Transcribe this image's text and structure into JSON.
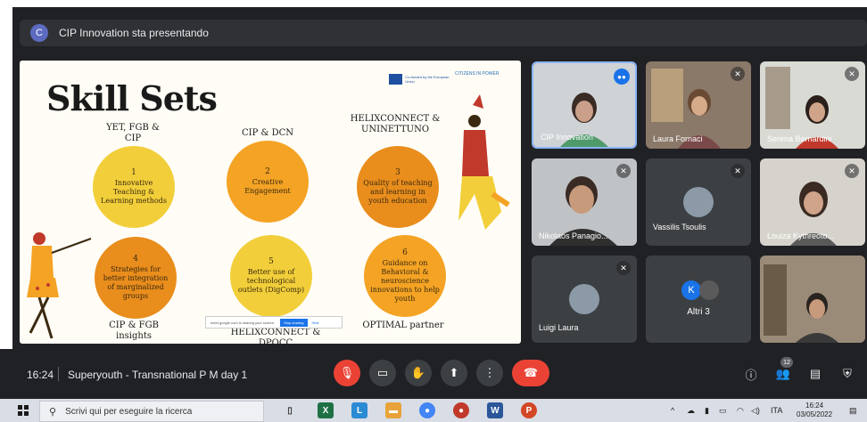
{
  "presenter": {
    "initial": "C",
    "text": "CIP Innovation sta presentando"
  },
  "slide": {
    "title": "Skill Sets",
    "eu_text": "Co-funded by the European Union",
    "citizens_text": "CITIZENS IN POWER",
    "partners": {
      "top_left": "YET, FGB & CIP",
      "top_mid": "CIP & DCN",
      "top_right": "HELIXCONNECT & UNINETTUNO",
      "bottom_left": "CIP & FGB insights",
      "bottom_mid": "HELIXCONNECT & DPOCC",
      "bottom_right": "OPTIMAL partner"
    },
    "circles": [
      {
        "num": "1",
        "text": "Innovative Teaching & Learning methods"
      },
      {
        "num": "2",
        "text": "Creative Engagement"
      },
      {
        "num": "3",
        "text": "Quality of teaching and learning in youth education"
      },
      {
        "num": "4",
        "text": "Strategies for better integration of marginalized groups"
      },
      {
        "num": "5",
        "text": "Better use of technological outlets (DigComp)"
      },
      {
        "num": "6",
        "text": "Guidance on Behavioral & neuroscience innovations to help youth"
      }
    ],
    "share": {
      "text": "meet.google.com is sharing your screen.",
      "stop": "Stop sharing",
      "hide": "Hide"
    }
  },
  "participants": [
    {
      "name": "CIP Innovation"
    },
    {
      "name": "Laura Fornaci"
    },
    {
      "name": "Serena Bernardini"
    },
    {
      "name": "Nikolaos Panagio..."
    },
    {
      "name": "Vassilis Tsoulis"
    },
    {
      "name": "Louiza Kythreoto..."
    },
    {
      "name": "Luigi Laura"
    },
    {
      "name": "Altri 3",
      "initial": "K"
    }
  ],
  "meeting": {
    "time": "16:24",
    "title": "Superyouth - Transnational P M day 1",
    "participant_count": "12"
  },
  "taskbar": {
    "search_placeholder": "Scrivi qui per eseguire la ricerca",
    "lang": "ITA",
    "clock_time": "16:24",
    "clock_date": "03/05/2022"
  },
  "colors": {
    "accent": "#1a73e8",
    "end_call": "#ea4335",
    "circle_yellow": "#f2cf3a",
    "circle_orange": "#f4a324"
  },
  "icons": [
    "mic-off-icon",
    "camera-icon",
    "raise-hand-icon",
    "present-icon",
    "more-icon",
    "end-call-icon",
    "info-icon",
    "people-icon",
    "chat-icon",
    "activities-icon"
  ]
}
